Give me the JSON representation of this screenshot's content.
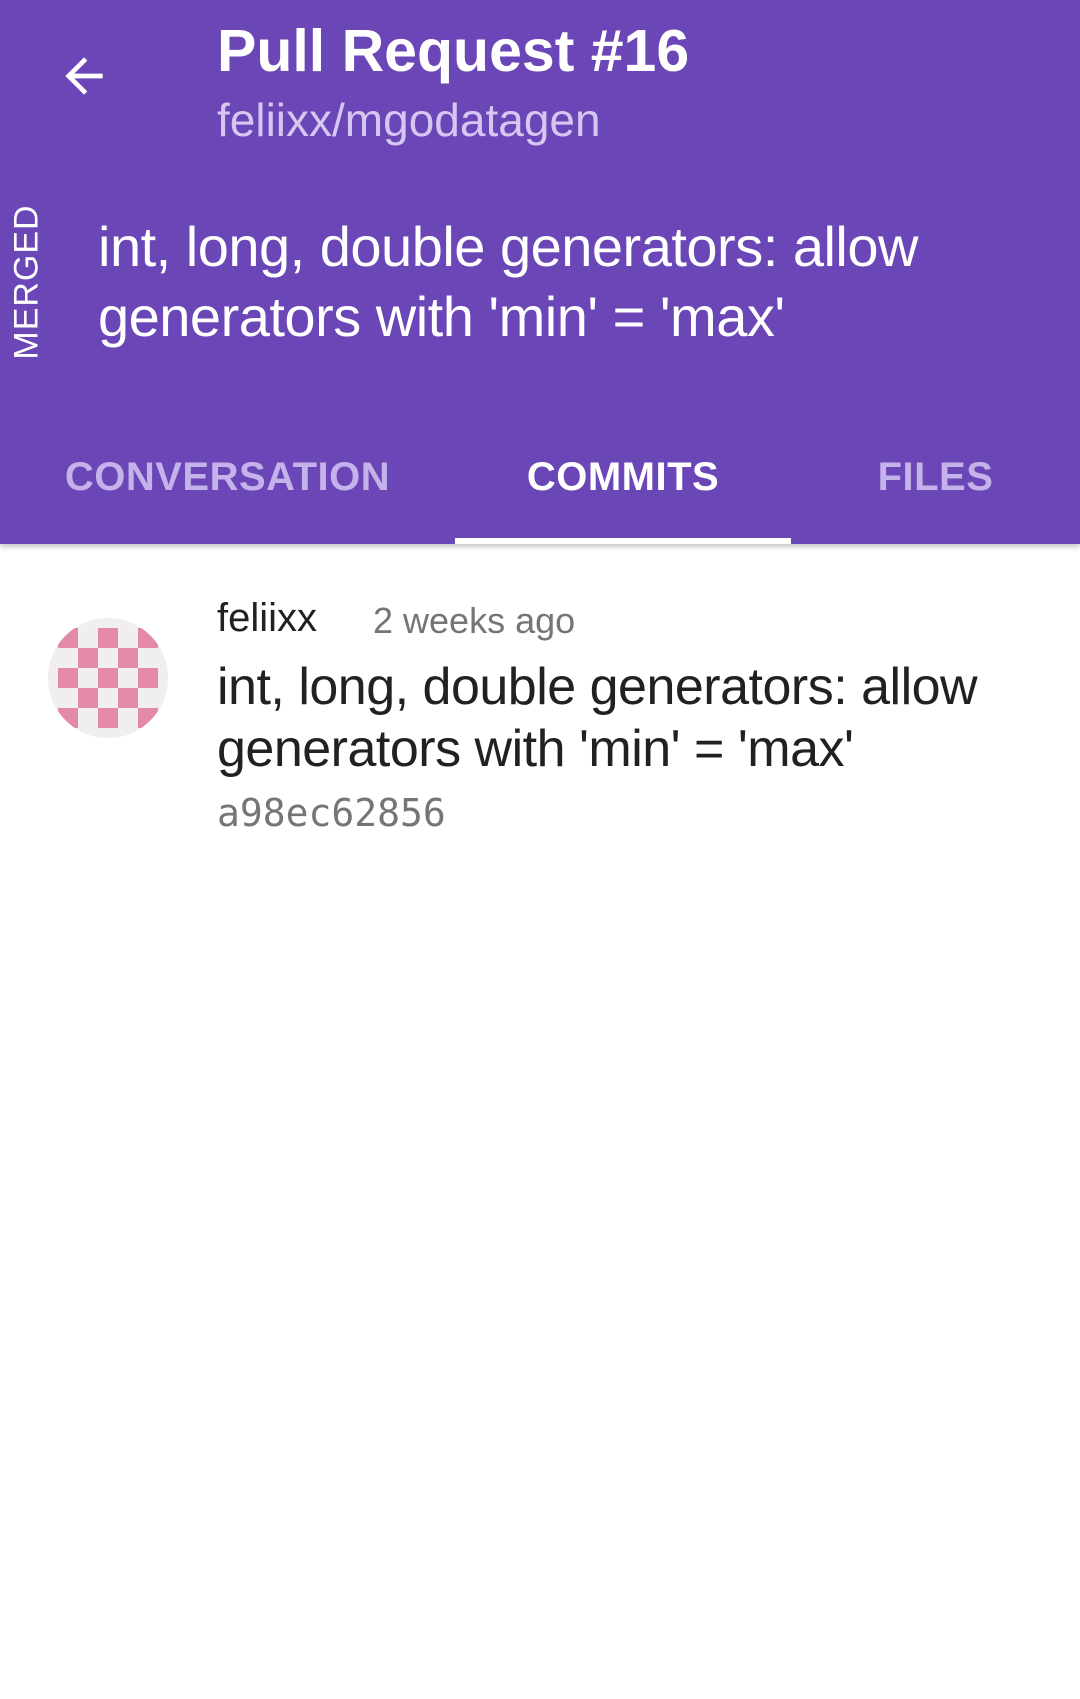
{
  "header": {
    "title": "Pull Request #16",
    "subtitle": "feliixx/mgodatagen",
    "state": "MERGED",
    "pr_title": "int, long, double generators: allow generators with 'min' = 'max'",
    "icons": {
      "back": "arrow-back-icon"
    },
    "colors": {
      "primary": "#6a46b6",
      "subtitle": "#d6c7f2",
      "tab_inactive": "#c4b2ea"
    }
  },
  "tabs": [
    {
      "label": "CONVERSATION",
      "active": false
    },
    {
      "label": "COMMITS",
      "active": true
    },
    {
      "label": "FILES",
      "active": false
    }
  ],
  "commits": [
    {
      "author": "feliixx",
      "time": "2 weeks ago",
      "message": "int, long, double generators: allow generators with 'min' = 'max'",
      "sha": "a98ec62856",
      "avatar_icon": "identicon-avatar",
      "avatar_color": "#e28aa6"
    }
  ]
}
